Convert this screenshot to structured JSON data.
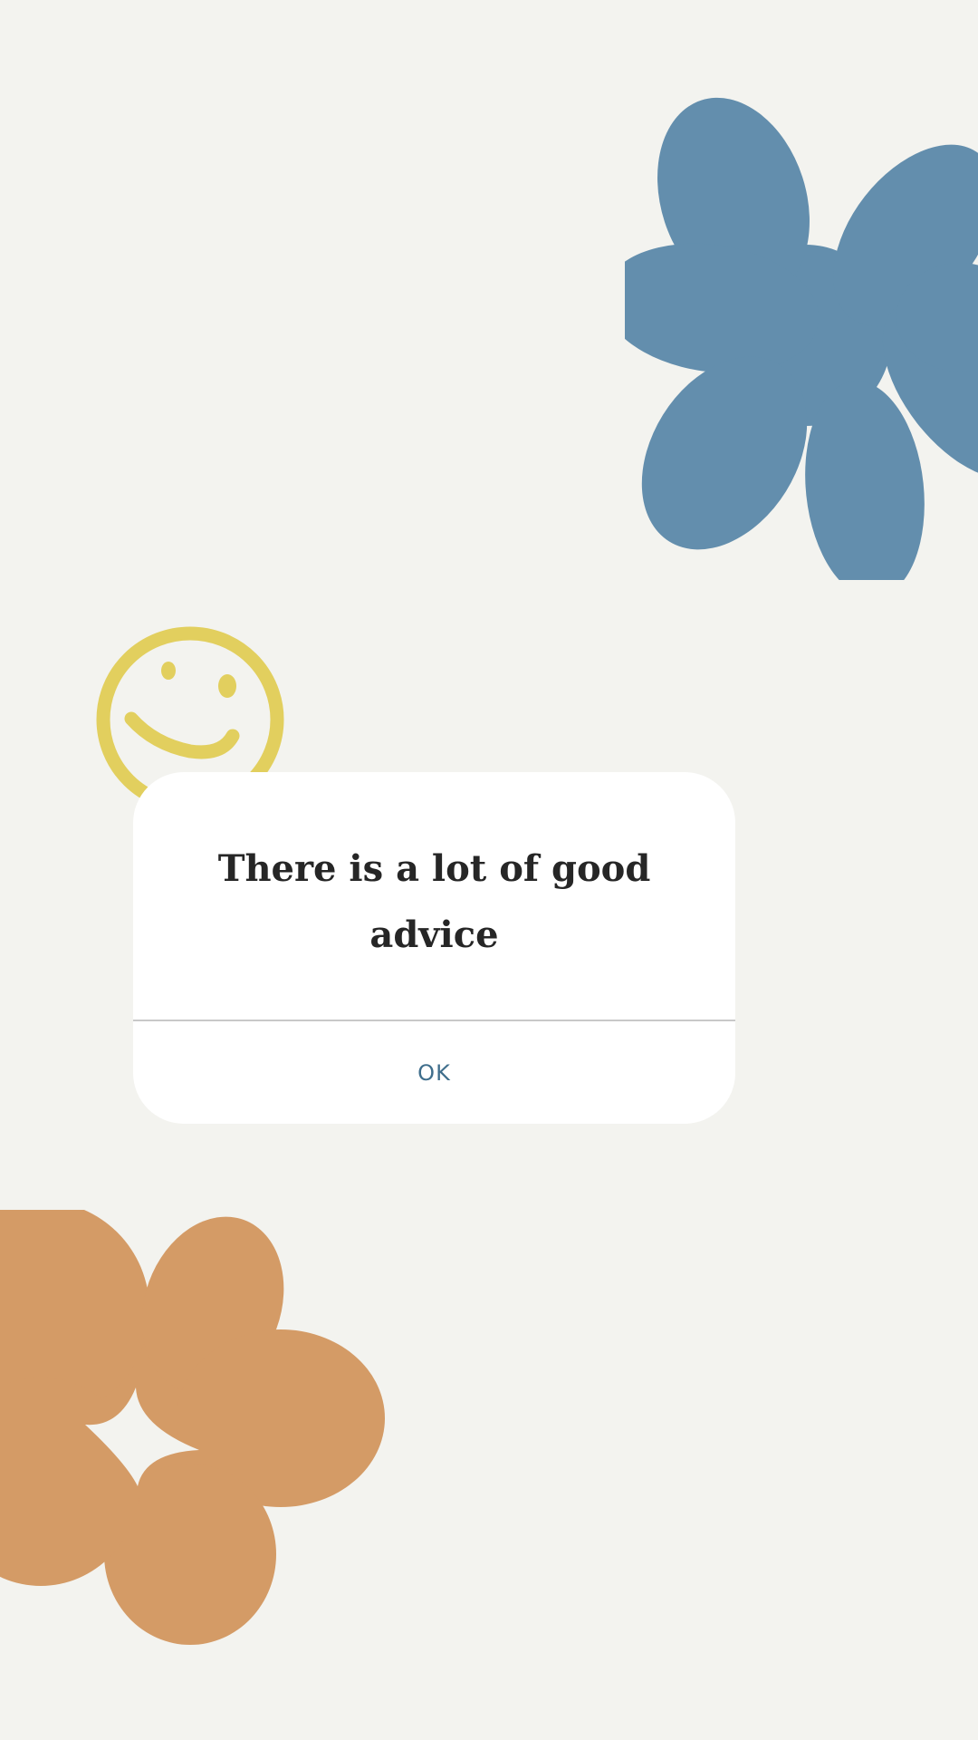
{
  "dialog": {
    "message": "There is a lot of good advice",
    "ok_label": "OK"
  },
  "decorations": {
    "blue_flower": "flower-icon",
    "smiley": "smiley-face-icon",
    "orange_flower": "flower-icon"
  },
  "colors": {
    "background": "#f3f3ef",
    "blue_flower": "#638ead",
    "smiley": "#e2cf5e",
    "orange_flower": "#d49b66",
    "accent": "#3f6e8c",
    "message_text": "#262626"
  }
}
